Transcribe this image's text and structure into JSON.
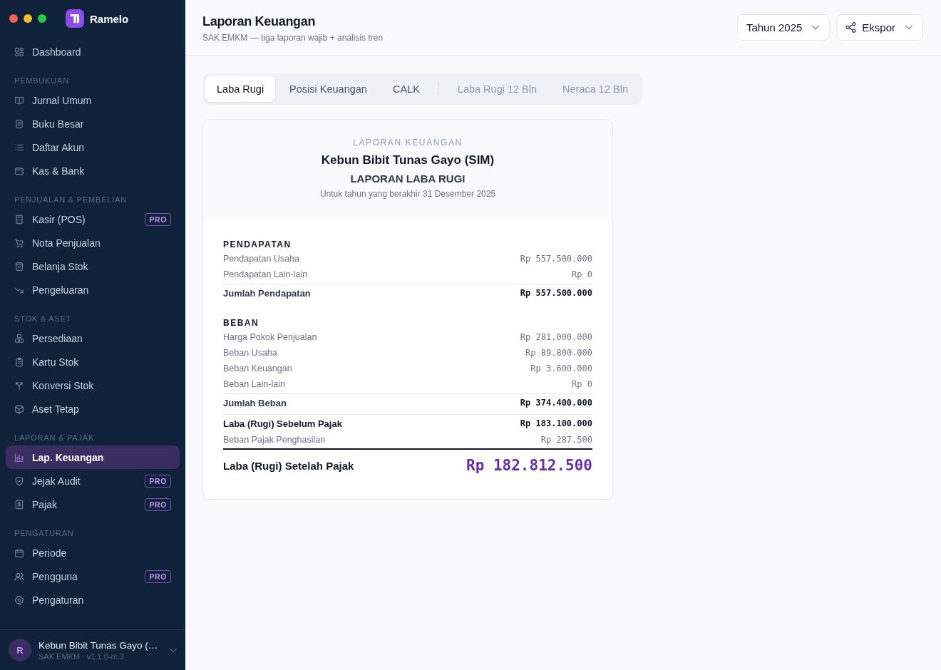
{
  "sidebar": {
    "brand": "Ramelo",
    "groups": [
      {
        "items": [
          {
            "label": "Dashboard",
            "selected": false
          }
        ]
      },
      {
        "heading": "PEMBUKUAN",
        "items": [
          {
            "label": "Jurnal Umum",
            "selected": false
          },
          {
            "label": "Buku Besar",
            "selected": false
          },
          {
            "label": "Daftar Akun",
            "selected": false
          },
          {
            "label": "Kas & Bank",
            "selected": false
          }
        ]
      },
      {
        "heading": "PENJUALAN & PEMBELIAN",
        "items": [
          {
            "label": "Kasir (POS)",
            "badge": "PRO",
            "selected": false
          },
          {
            "label": "Nota Penjualan",
            "selected": false
          },
          {
            "label": "Belanja Stok",
            "selected": false
          },
          {
            "label": "Pengeluaran",
            "selected": false
          }
        ]
      },
      {
        "heading": "STOK & ASET",
        "items": [
          {
            "label": "Persediaan",
            "selected": false
          },
          {
            "label": "Kartu Stok",
            "selected": false
          },
          {
            "label": "Konversi Stok",
            "selected": false
          },
          {
            "label": "Aset Tetap",
            "selected": false
          }
        ]
      },
      {
        "heading": "LAPORAN & PAJAK",
        "items": [
          {
            "label": "Lap. Keuangan",
            "selected": true
          },
          {
            "label": "Jejak Audit",
            "badge": "PRO",
            "selected": false
          },
          {
            "label": "Pajak",
            "badge": "PRO",
            "selected": false
          }
        ]
      },
      {
        "heading": "PENGATURAN",
        "items": [
          {
            "label": "Periode",
            "selected": false
          },
          {
            "label": "Pengguna",
            "badge": "PRO",
            "selected": false
          },
          {
            "label": "Pengaturan",
            "selected": false
          }
        ]
      }
    ],
    "account": {
      "initial": "R",
      "name": "Kebun Bibit Tunas Gayo (…",
      "subtitle": "SAK EMKM · v1.1.0-rc.3"
    }
  },
  "header": {
    "title": "Laporan Keuangan",
    "subtitle": "SAK EMKM — tiga laporan wajib + analisis tren",
    "year_select": {
      "value": "Tahun 2025"
    },
    "export_button": {
      "label": "Ekspor"
    }
  },
  "tabs": [
    {
      "label": "Laba Rugi",
      "kind": "statement",
      "selected": true
    },
    {
      "label": "Posisi Keuangan",
      "kind": "statement",
      "selected": false
    },
    {
      "label": "CALK",
      "kind": "statement",
      "selected": false
    },
    {
      "label": "Laba Rugi 12 Bln",
      "kind": "trend",
      "selected": false
    },
    {
      "label": "Neraca 12 Bln",
      "kind": "trend",
      "selected": false
    }
  ],
  "report": {
    "eyebrow": "LAPORAN KEUANGAN",
    "company": "Kebun Bibit Tunas Gayo (SIM)",
    "title": "LAPORAN LABA RUGI",
    "period": "Untuk tahun yang berakhir 31 Desember 2025",
    "rows": [
      {
        "kind": "heading",
        "label": "PENDAPATAN"
      },
      {
        "kind": "line",
        "label": "Pendapatan Usaha",
        "amount": "Rp 557.500.000"
      },
      {
        "kind": "line",
        "label": "Pendapatan Lain-lain",
        "amount": "Rp 0"
      },
      {
        "kind": "total",
        "label": "Jumlah Pendapatan",
        "amount": "Rp 557.500.000"
      },
      {
        "kind": "heading",
        "label": "BEBAN"
      },
      {
        "kind": "line",
        "label": "Harga Pokok Penjualan",
        "amount": "Rp 281.000.000"
      },
      {
        "kind": "line",
        "label": "Beban Usaha",
        "amount": "Rp 89.800.000"
      },
      {
        "kind": "line",
        "label": "Beban Keuangan",
        "amount": "Rp 3.600.000"
      },
      {
        "kind": "line",
        "label": "Beban Lain-lain",
        "amount": "Rp 0"
      },
      {
        "kind": "total",
        "label": "Jumlah Beban",
        "amount": "Rp 374.400.000"
      },
      {
        "kind": "profit",
        "label": "Laba (Rugi) Sebelum Pajak",
        "amount": "Rp 183.100.000"
      },
      {
        "kind": "line",
        "label": "Beban Pajak Penghasilan",
        "amount": "Rp 287.500"
      },
      {
        "kind": "grand",
        "label": "Laba (Rugi) Setelah Pajak",
        "amount": "Rp 182.812.500"
      }
    ]
  }
}
